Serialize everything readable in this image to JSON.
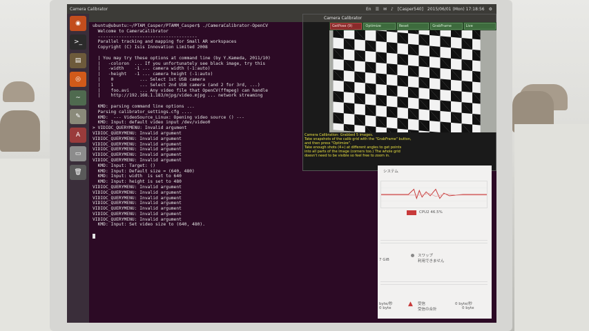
{
  "topbar": {
    "title": "Camera Calibrator",
    "tray": [
      "En",
      "☰",
      "✉",
      "♪",
      "[Casper540]",
      "2015/06/01 (Mon) 17:18:56",
      "⚙"
    ]
  },
  "launcher": {
    "items": [
      {
        "name": "dash-home",
        "glyph": "◉",
        "color": "#c24d1d"
      },
      {
        "name": "terminal",
        "glyph": ">_",
        "color": "#2b2b2b"
      },
      {
        "name": "files",
        "glyph": "▤",
        "color": "#6d5a3b"
      },
      {
        "name": "firefox",
        "glyph": "◎",
        "color": "#d05a1a"
      },
      {
        "name": "system-monitor",
        "glyph": "~",
        "color": "#4f6a4f"
      },
      {
        "name": "text-editor",
        "glyph": "✎",
        "color": "#8a8a7a"
      },
      {
        "name": "software-center",
        "glyph": "A",
        "color": "#9a3b3b"
      },
      {
        "name": "drive",
        "glyph": "▭",
        "color": "#8c8c8c"
      },
      {
        "name": "trash",
        "glyph": "🗑",
        "color": "#5a5a5a"
      }
    ]
  },
  "terminal": {
    "lines": [
      "ubuntu@ubuntu:~/PTAM_Casper/PTAMM_Casper$ ./CameraCalibrator-OpenCV",
      "  Welcome to CameraCalibrator",
      "  --------------------------------------",
      "  Parallel tracking and mapping for Small AR workspaces",
      "  Copyright (C) Isis Innovation Limited 2008",
      "",
      "  | You may try these options at command line (by Y.Kameda, 2011/10)",
      "  |   -coloron  ... If you unfortunately see black image, try this",
      "  |   -width    -1 ... camera width (-1:auto)",
      "  |   -height   -1 ... camera height (-1:auto)",
      "  |    0          ... Select 1st USB camera",
      "  |    1          ... Select 2nd USB camera (and 2 for 3rd, ...)",
      "  |    foo.avi    ... Any video file that OpenCV(ffmpeg) can handle",
      "  |    http://192.168.1.183/mjpg/video.mjpg ... network streaming",
      "",
      "  KMD: parsing command line options ...",
      "  Parsing calibrator_settings.cfg ....",
      "  KMD:  --- VideoSource_Linux: Opening video source () ---",
      "  KMD: Input: default video input /dev/video0",
      "> VIDIOC_QUERYMENU: Invalid argument",
      "VIDIOC_QUERYMENU: Invalid argument",
      "VIDIOC_QUERYMENU: Invalid argument",
      "VIDIOC_QUERYMENU: Invalid argument",
      "VIDIOC_QUERYMENU: Invalid argument",
      "VIDIOC_QUERYMENU: Invalid argument",
      "VIDIOC_QUERYMENU: Invalid argument",
      "  KMD: Input: Target: ()",
      "  KMD: Input: Default size = (640, 480)",
      "  KMD: Input: width  is set to 640",
      "  KMD: Input: height is set to 480",
      "VIDIOC_QUERYMENU: Invalid argument",
      "VIDIOC_QUERYMENU: Invalid argument",
      "VIDIOC_QUERYMENU: Invalid argument",
      "VIDIOC_QUERYMENU: Invalid argument",
      "VIDIOC_QUERYMENU: Invalid argument",
      "VIDIOC_QUERYMENU: Invalid argument",
      "VIDIOC_QUERYMENU: Invalid argument",
      "  KMD: Input: Set video size to (640, 480)."
    ]
  },
  "calibrator": {
    "title": "Camera Calibrator",
    "buttons": [
      {
        "label": "GetPose (9)",
        "style": "red"
      },
      {
        "label": "Optimize",
        "style": "green"
      },
      {
        "label": "Reset",
        "style": "green"
      },
      {
        "label": "GrabFrame",
        "style": "green"
      },
      {
        "label": "Live",
        "style": "green"
      }
    ],
    "message": [
      "Camera Calibration: Grabbed 5 images.",
      "Take snapshots of the calib grid with the \"GrabFrame\" button,",
      "and then press \"Optimize\".",
      "Take enough shots (4+) at different angles to get points",
      "into all parts of the image (corners too.) The whole grid",
      "doesn't need to be visible so feel free to zoom in."
    ]
  },
  "sysmon": {
    "header": "システム",
    "cpu_label": "CPU2 46.5%",
    "memory_label": "7 GiB",
    "swap_label": "スワップ",
    "swap_status": "利用できません",
    "recv_label": "受信",
    "recv_total_label": "受信の合計",
    "recv_rate": "0 byte/秒",
    "recv_total": "0 byte",
    "send_rate_left": "byte/秒",
    "send_total_left": "0 byte",
    "cpu_color": "#c83a3a"
  }
}
